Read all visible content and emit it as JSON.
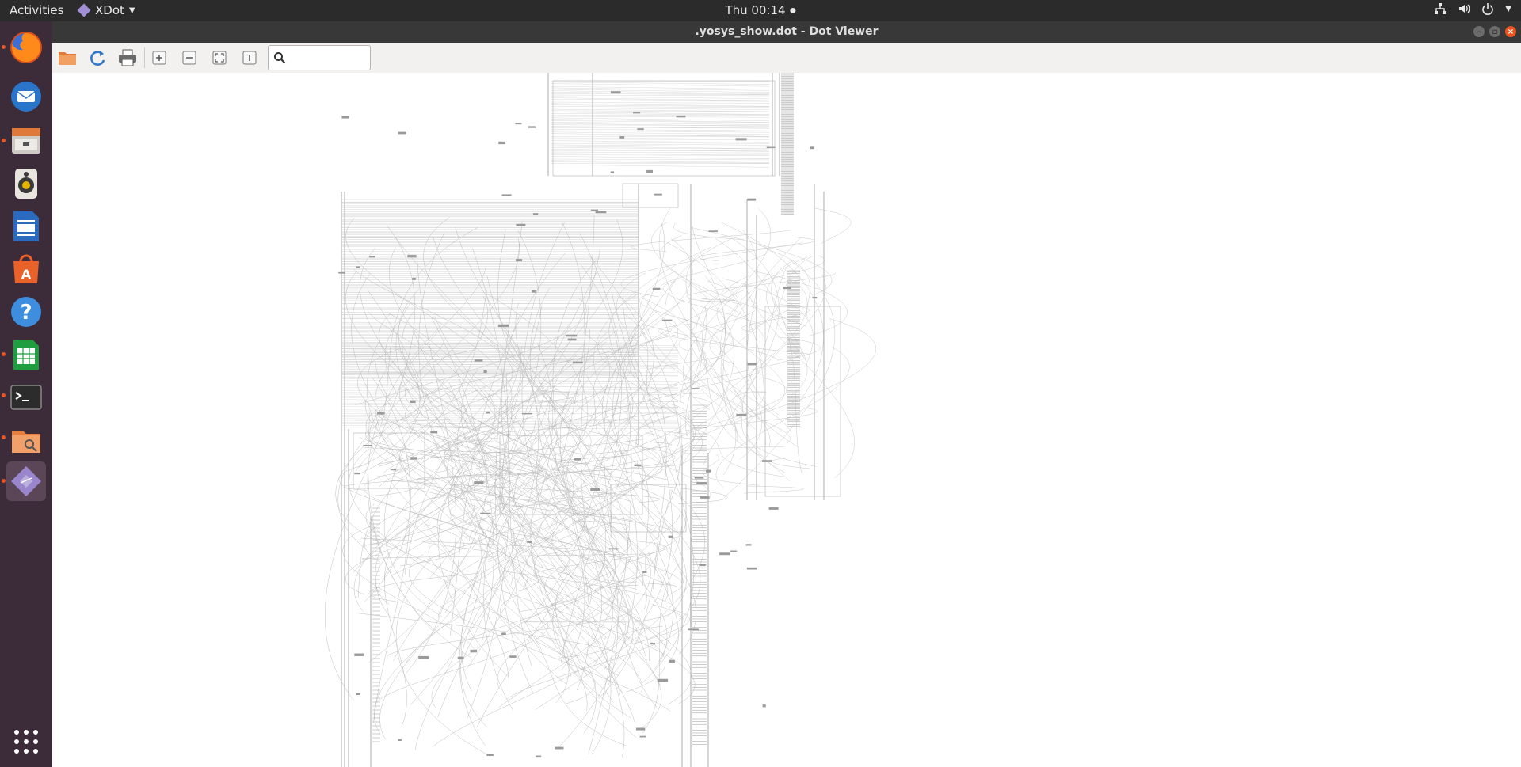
{
  "topbar": {
    "activities": "Activities",
    "app_name": "XDot",
    "clock": "Thu 00:14",
    "status_icons": [
      "network-icon",
      "volume-icon",
      "power-icon"
    ]
  },
  "dock": {
    "items": [
      {
        "name": "firefox",
        "icon": "firefox-icon",
        "running": true
      },
      {
        "name": "thunderbird",
        "icon": "mail-icon",
        "running": false
      },
      {
        "name": "files-archive",
        "icon": "drawer-icon",
        "running": true
      },
      {
        "name": "rhythmbox",
        "icon": "speaker-icon",
        "running": false
      },
      {
        "name": "libreoffice-writer",
        "icon": "writer-icon",
        "running": false
      },
      {
        "name": "software",
        "icon": "store-icon",
        "running": false
      },
      {
        "name": "help",
        "icon": "help-icon",
        "running": false
      },
      {
        "name": "libreoffice-calc",
        "icon": "calc-icon",
        "running": true
      },
      {
        "name": "terminal",
        "icon": "terminal-icon",
        "running": true
      },
      {
        "name": "file-manager",
        "icon": "folder-search-icon",
        "running": true
      },
      {
        "name": "xdot",
        "icon": "xdot-icon",
        "running": true
      }
    ],
    "show_apps_icon": "app-grid-icon"
  },
  "window": {
    "title": ".yosys_show.dot - Dot Viewer"
  },
  "toolbar": {
    "buttons": [
      "open-icon",
      "reload-icon",
      "print-icon",
      "zoom-in-icon",
      "zoom-out-icon",
      "zoom-fit-icon",
      "zoom-100-icon"
    ],
    "search_value": "",
    "search_placeholder": ""
  },
  "colors": {
    "accent": "#e95420",
    "dock_bg": "#3c2b38",
    "topbar_bg": "#2b2b2b",
    "toolbar_bg": "#f2f1f0"
  }
}
